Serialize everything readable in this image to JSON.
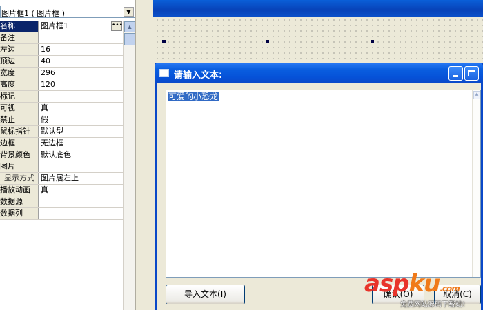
{
  "property_panel": {
    "object_selector": "图片框1 ( 图片框 )",
    "rows": [
      {
        "name": "名称",
        "value": "图片框1"
      },
      {
        "name": "备注",
        "value": ""
      },
      {
        "name": "左边",
        "value": "16"
      },
      {
        "name": "顶边",
        "value": "40"
      },
      {
        "name": "宽度",
        "value": "296"
      },
      {
        "name": "高度",
        "value": "120"
      },
      {
        "name": "标记",
        "value": ""
      },
      {
        "name": "可视",
        "value": "真"
      },
      {
        "name": "禁止",
        "value": "假"
      },
      {
        "name": "鼠标指针",
        "value": "默认型"
      },
      {
        "name": "边框",
        "value": "无边框"
      },
      {
        "name": "背景颜色",
        "value": "默认底色"
      },
      {
        "name": "图片",
        "value": ""
      },
      {
        "name": "显示方式",
        "value": "图片居左上"
      },
      {
        "name": "播放动画",
        "value": "真"
      },
      {
        "name": "数据源",
        "value": ""
      },
      {
        "name": "数据列",
        "value": ""
      }
    ],
    "ellipsis_label": "•••"
  },
  "dialog": {
    "title": "请输入文本:",
    "text_value": "可爱的小恐龙",
    "import_button": "导入文本(I)",
    "ok_button": "确认(O)",
    "cancel_button": "取消(C)"
  },
  "watermark": {
    "logo_a": "asp",
    "logo_b": "ku",
    "logo_suffix": ".com",
    "subtitle": "免费网站源码下载站!"
  },
  "colors": {
    "selection": "#0a246a",
    "titlebar": "#0a5fe0",
    "text_highlight": "#316ac5"
  }
}
